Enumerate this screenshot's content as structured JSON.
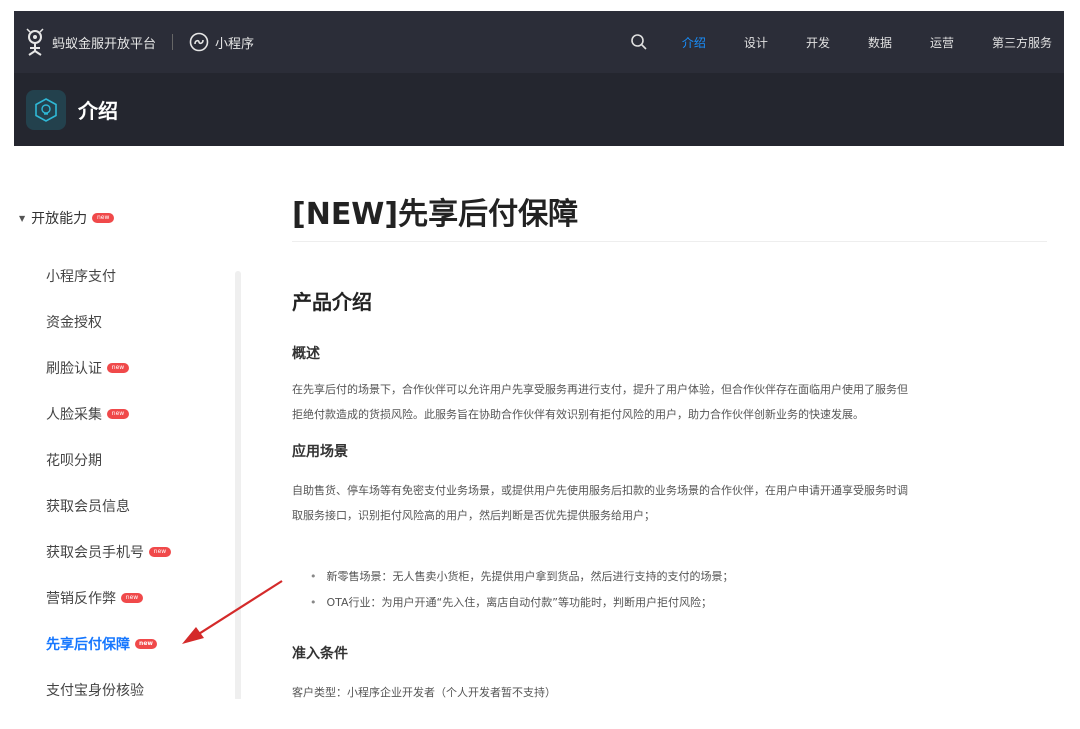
{
  "topbar": {
    "brand": "蚂蚁金服开放平台",
    "mini_program": "小程序",
    "nav": [
      "介绍",
      "设计",
      "开发",
      "数据",
      "运营",
      "第三方服务"
    ],
    "active_index": 0
  },
  "subbar": {
    "title": "介绍"
  },
  "sidebar": {
    "group": "开放能力",
    "items": [
      {
        "label": "小程序支付",
        "new": false
      },
      {
        "label": "资金授权",
        "new": false
      },
      {
        "label": "刷脸认证",
        "new": true
      },
      {
        "label": "人脸采集",
        "new": true
      },
      {
        "label": "花呗分期",
        "new": false
      },
      {
        "label": "获取会员信息",
        "new": false
      },
      {
        "label": "获取会员手机号",
        "new": true
      },
      {
        "label": "营销反作弊",
        "new": true
      },
      {
        "label": "先享后付保障",
        "new": true,
        "active": true
      },
      {
        "label": "支付宝身份核验",
        "new": false
      }
    ]
  },
  "content": {
    "title": "[NEW]先享后付保障",
    "section": "产品介绍",
    "overview_heading": "概述",
    "overview_text": [
      "在先享后付的场景下，合作伙伴可以允许用户先享受服务再进行支付，提升了用户体验，但合作伙伴存在面临用户使用了服务但",
      "拒绝付款造成的货损风险。此服务旨在协助合作伙伴有效识别有拒付风险的用户，助力合作伙伴创新业务的快速发展。"
    ],
    "scenario_heading": "应用场景",
    "scenario_text": [
      "自助售货、停车场等有免密支付业务场景，或提供用户先使用服务后扣款的业务场景的合作伙伴，在用户申请开通享受服务时调",
      "取服务接口，识别拒付风险高的用户，然后判断是否优先提供服务给用户；"
    ],
    "bullets": [
      "新零售场景：无人售卖小货柜，先提供用户拿到货品，然后进行支持的支付的场景；",
      "OTA行业：为用户开通“先入住，离店自动付款”等功能时，判断用户拒付风险；"
    ],
    "access_heading": "准入条件",
    "access_text": "客户类型：小程序企业开发者（个人开发者暂不支持）"
  },
  "colors": {
    "topbar": "#2b2d38",
    "accent": "#1890ff",
    "badge": "#f0494a",
    "arrow": "#d42a2a"
  }
}
